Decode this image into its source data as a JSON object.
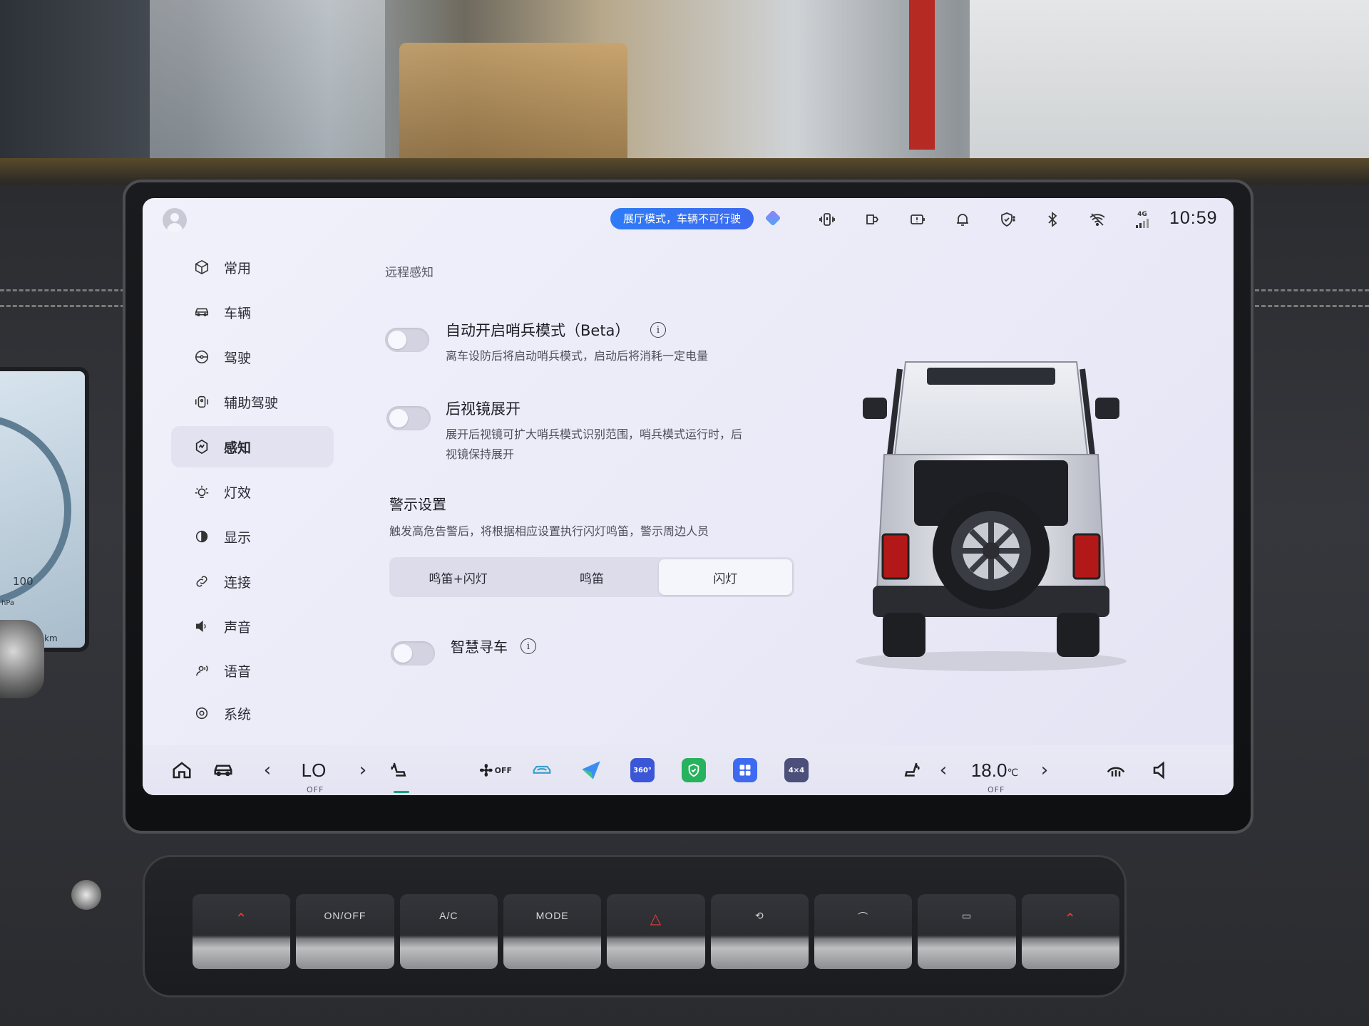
{
  "status_bar": {
    "mode_pill": "展厅模式，车辆不可行驶",
    "clock": "10:59",
    "signal_label": "4G",
    "icons": [
      "user-avatar-icon",
      "assistant-gem-icon",
      "vibration-icon",
      "mirror-icon",
      "battery-warning-icon",
      "bell-icon",
      "shield-icon",
      "bluetooth-icon",
      "wifi-icon",
      "cellular-signal-icon"
    ]
  },
  "sidebar": {
    "items": [
      {
        "label": "常用",
        "icon": "cube-icon"
      },
      {
        "label": "车辆",
        "icon": "car-icon"
      },
      {
        "label": "驾驶",
        "icon": "steering-wheel-icon"
      },
      {
        "label": "辅助驾驶",
        "icon": "assist-drive-icon"
      },
      {
        "label": "感知",
        "icon": "sensing-icon",
        "active": true
      },
      {
        "label": "灯效",
        "icon": "light-icon"
      },
      {
        "label": "显示",
        "icon": "display-icon"
      },
      {
        "label": "连接",
        "icon": "link-icon"
      },
      {
        "label": "声音",
        "icon": "speaker-icon"
      },
      {
        "label": "语音",
        "icon": "voice-icon"
      },
      {
        "label": "系统",
        "icon": "system-icon"
      }
    ]
  },
  "main": {
    "section_label": "远程感知",
    "sentry": {
      "title": "自动开启哨兵模式（Beta）",
      "desc": "离车设防后将启动哨兵模式，启动后将消耗一定电量",
      "enabled": false
    },
    "mirror": {
      "title": "后视镜展开",
      "desc_line1": "展开后视镜可扩大哨兵模式识别范围，哨兵模式运行时，后",
      "desc_line2": "视镜保持展开",
      "enabled": false
    },
    "alert": {
      "title": "警示设置",
      "desc": "触发高危告警后，将根据相应设置执行闪灯鸣笛，警示周边人员",
      "options": [
        "鸣笛+闪灯",
        "鸣笛",
        "闪灯"
      ],
      "selected": "闪灯"
    },
    "find_car": {
      "title": "智慧寻车",
      "enabled": false
    }
  },
  "dock": {
    "left_temp": "LO",
    "left_temp_state": "OFF",
    "fan_label": "OFF",
    "app_360_label": "360°",
    "app_4x4_label": "4×4",
    "right_temp": "18.0",
    "right_temp_unit": "℃",
    "right_temp_state": "OFF"
  },
  "hard_keys": {
    "labels": [
      "",
      "ON/OFF",
      "A/C",
      "MODE",
      "",
      "",
      "",
      "",
      ""
    ]
  },
  "colors": {
    "accent": "#2e7cf6",
    "active_indicator": "#1aa37a",
    "screen_bg": "#eeeef9"
  }
}
